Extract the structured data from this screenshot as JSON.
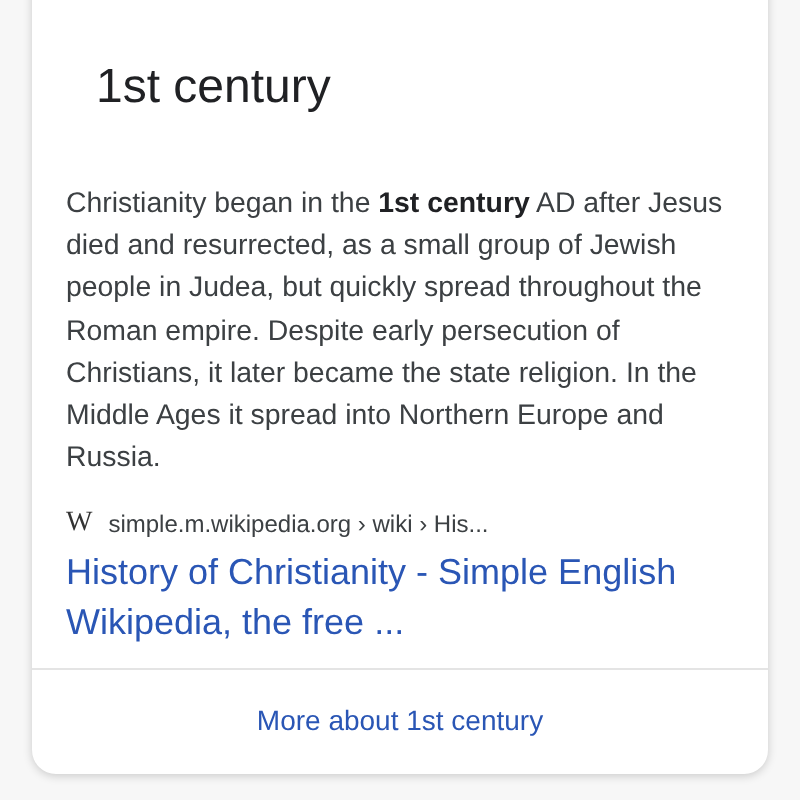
{
  "card": {
    "title": "1st century",
    "snippet": "Christianity began in the **1st century** AD after Jesus died and resurrected, as a small group of Jewish people in Judea, but quickly spread throughout the Roman empire. Despite early persecution of Christians, it later became the state religion. In the Middle Ages it spread into Northern Europe and Russia.",
    "source": {
      "favicon": "W",
      "breadcrumb": "simple.m.wikipedia.org › wiki › His..."
    },
    "link": "History of Christianity - Simple English Wikipedia, the free ...",
    "more": "More about 1st century"
  }
}
